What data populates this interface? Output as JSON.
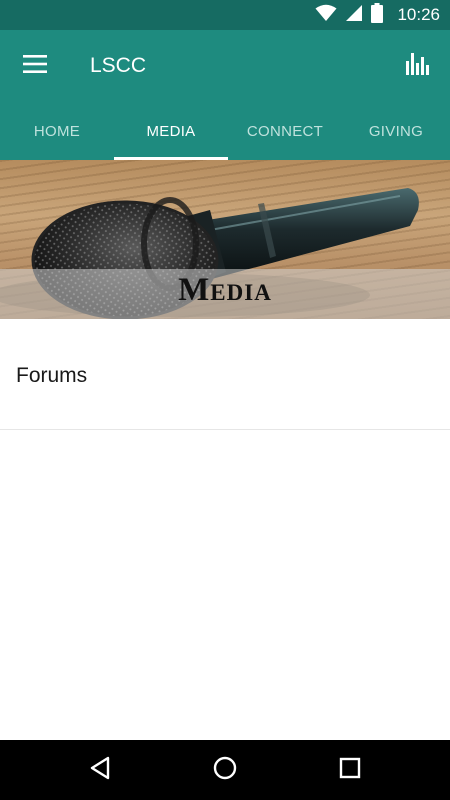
{
  "status_bar": {
    "time": "10:26",
    "icons": [
      "wifi-icon",
      "cell-signal-icon",
      "battery-icon"
    ]
  },
  "app_bar": {
    "title": "LSCC",
    "menu_icon": "hamburger-menu-icon",
    "action_icon": "bar-chart-icon"
  },
  "tabs": [
    {
      "label": "HOME",
      "active": false
    },
    {
      "label": "MEDIA",
      "active": true
    },
    {
      "label": "CONNECT",
      "active": false
    },
    {
      "label": "GIVING",
      "active": false
    }
  ],
  "banner": {
    "caption": "Media",
    "image": "microphone-photo"
  },
  "list": {
    "items": [
      {
        "label": "Forums"
      }
    ]
  },
  "nav_bar": {
    "icons": [
      "back-icon",
      "home-icon",
      "recents-icon"
    ]
  },
  "colors": {
    "status_bar": "#166b62",
    "primary": "#1e8b7f",
    "tab_inactive": "#bfe2dd",
    "tab_active": "#ffffff",
    "nav_bar": "#000000"
  }
}
